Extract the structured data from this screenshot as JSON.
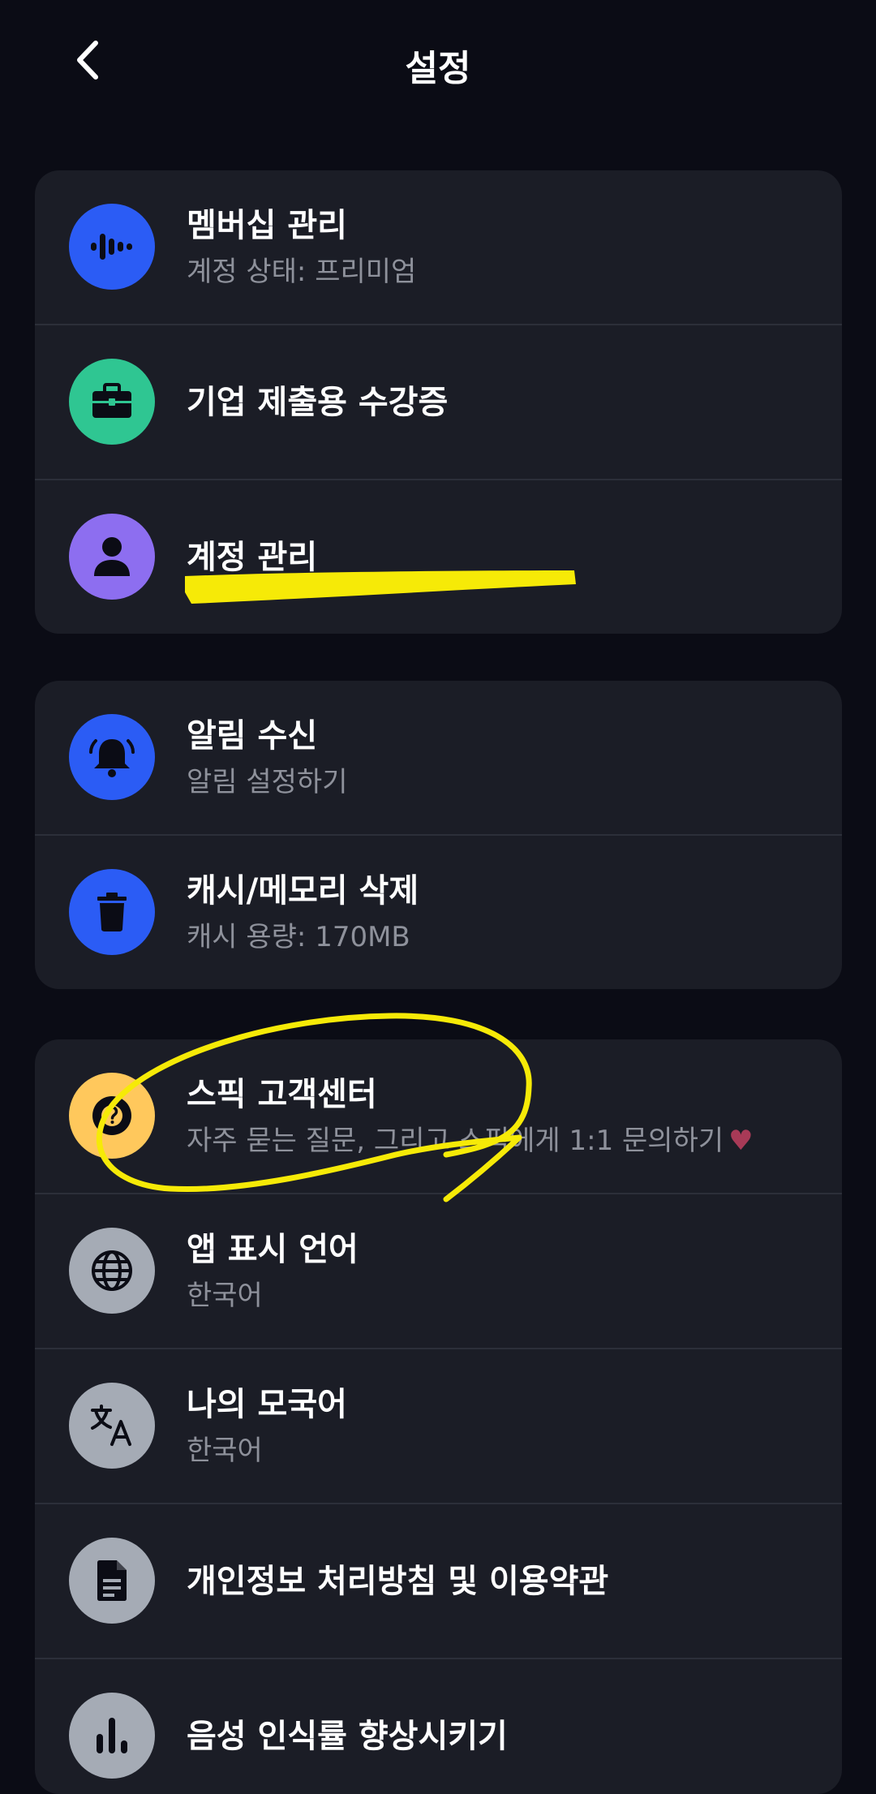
{
  "header": {
    "title": "설정"
  },
  "groups": [
    {
      "items": [
        {
          "title": "멤버십 관리",
          "subtitle": "계정 상태: 프리미엄"
        },
        {
          "title": "기업 제출용 수강증"
        },
        {
          "title": "계정 관리"
        }
      ]
    },
    {
      "items": [
        {
          "title": "알림 수신",
          "subtitle": "알림 설정하기"
        },
        {
          "title": "캐시/메모리 삭제",
          "subtitle": "캐시 용량: 170MB"
        }
      ]
    },
    {
      "items": [
        {
          "title": "스픽 고객센터",
          "subtitle": "자주 묻는 질문, 그리고 스픽에게 1:1 문의하기"
        },
        {
          "title": "앱 표시 언어",
          "subtitle": "한국어"
        },
        {
          "title": "나의 모국어",
          "subtitle": "한국어"
        },
        {
          "title": "개인정보 처리방침 및 이용약관"
        },
        {
          "title": "음성 인식률 향상시키기"
        }
      ]
    }
  ],
  "icons": {
    "membership": "voice-wave-icon",
    "certificate": "briefcase-icon",
    "account": "person-icon",
    "notification": "bell-ringing-icon",
    "cache": "trash-icon",
    "support": "help-icon",
    "app_language": "globe-icon",
    "native_language": "translate-icon",
    "privacy": "document-icon",
    "voice_recognition": "bar-chart-icon"
  },
  "colors": {
    "background": "#0b0c15",
    "card": "#1b1d26",
    "blue": "#2b5cf5",
    "green": "#2fc692",
    "purple": "#8d6ef0",
    "yellow": "#ffc85c",
    "gray": "#a5abb5",
    "highlight": "#f6ea07"
  }
}
